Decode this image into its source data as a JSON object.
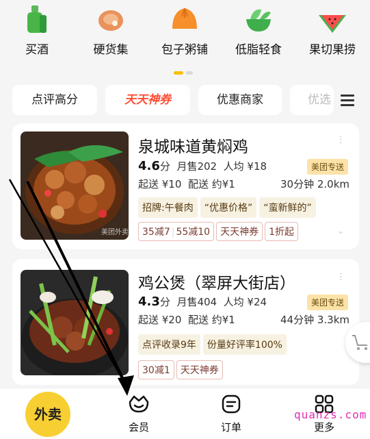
{
  "categories": [
    {
      "label": "买酒",
      "icon": "liquor-bottle-icon"
    },
    {
      "label": "硬货集",
      "icon": "steak-icon"
    },
    {
      "label": "包子粥铺",
      "icon": "bun-icon"
    },
    {
      "label": "低脂轻食",
      "icon": "salad-bowl-icon"
    },
    {
      "label": "果切果捞",
      "icon": "watermelon-icon"
    }
  ],
  "filters": [
    "点评高分",
    "天天神券",
    "优惠商家",
    "优选"
  ],
  "stores": [
    {
      "name": "泉城味道黄焖鸡",
      "score": "4.6",
      "score_unit": "分",
      "monthly_sales": "月售202",
      "avg_price": "人均 ¥18",
      "badge": "美团专送",
      "min_order": "起送 ¥10",
      "delivery_fee": "配送 约¥1",
      "eta_distance": "30分钟 2.0km",
      "tags": [
        "招牌:午餐肉",
        "“优惠价格”",
        "“蛮新鲜的”"
      ],
      "coupons": [
        "35减7",
        "55减10",
        "天天神券",
        "1折起"
      ]
    },
    {
      "name": "鸡公煲（翠屏大街店）",
      "score": "4.3",
      "score_unit": "分",
      "monthly_sales": "月售404",
      "avg_price": "人均 ¥24",
      "badge": "美团专送",
      "min_order": "起送 ¥20",
      "delivery_fee": "配送 约¥1",
      "eta_distance": "44分钟 3.3km",
      "tags": [
        "点评收录9年",
        "份量好评率100%"
      ],
      "coupons": [
        "30减1",
        "天天神券"
      ]
    }
  ],
  "nav": {
    "home": "外卖",
    "member": "会员",
    "orders": "订单",
    "more": "更多"
  },
  "watermark": "quanzs.com",
  "photo_watermark": "美团外卖",
  "colors": {
    "accent": "#f8cf32",
    "hot": "#ff4d33",
    "badge_bg": "#fbe3a8",
    "watermark": "#e02db5"
  }
}
